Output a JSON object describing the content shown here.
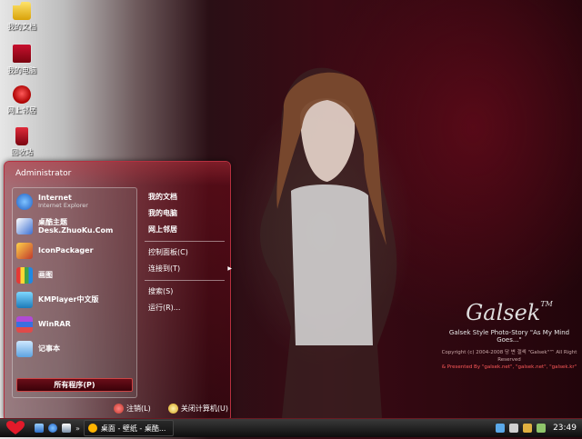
{
  "desktop": {
    "icons": [
      {
        "label": "我的文档",
        "icon": "my-documents-icon"
      },
      {
        "label": "我的电脑",
        "icon": "my-computer-icon"
      },
      {
        "label": "网上邻居",
        "icon": "network-icon"
      },
      {
        "label": "回收站",
        "icon": "recycle-bin-icon"
      }
    ]
  },
  "start_menu": {
    "user": "Administrator",
    "programs": [
      {
        "title": "Internet",
        "subtitle": "Internet Explorer",
        "icon": "internet-explorer-icon",
        "color": "#2a7de1"
      },
      {
        "title": "桌酷主题Desk.ZhuoKu.Com",
        "icon": "zhuoku-theme-icon",
        "color": "#3b6fd1"
      },
      {
        "title": "IconPackager",
        "icon": "iconpackager-icon",
        "color": "#d6a11a"
      },
      {
        "title": "画图",
        "icon": "paint-icon",
        "color": "#e0b441"
      },
      {
        "title": "KMPlayer中文版",
        "icon": "kmplayer-icon",
        "color": "#2fa6d8"
      },
      {
        "title": "WinRAR",
        "icon": "winrar-icon",
        "color": "#7b3ea8"
      },
      {
        "title": "记事本",
        "icon": "notepad-icon",
        "color": "#6fb1e8"
      }
    ],
    "all_programs": "所有程序(P)",
    "right": {
      "group1": [
        "我的文档",
        "我的电脑",
        "网上邻居"
      ],
      "group2": [
        "控制面板(C)",
        "连接到(T)"
      ],
      "group3": [
        "搜索(S)",
        "运行(R)..."
      ]
    },
    "footer": {
      "logoff": "注销(L)",
      "shutdown": "关闭计算机(U)"
    }
  },
  "branding": {
    "logo": "Galsek",
    "tm": "TM",
    "tagline": "Galsek Style Photo-Story \"As My Mind Goes...\"",
    "copyright": "Copyright (c) 2004-2008 당 변 갤섹 \"Galsek\"™ All Right Reserved",
    "presented": "& Presented By \"galsek.net\", \"galsek.net\", \"galsek.kr\""
  },
  "taskbar": {
    "task_label": "桌面 - 壁纸 - 桌酷...",
    "clock": "23:49"
  },
  "colors": {
    "accent": "#b62f3f",
    "brand_red": "#ff5a5a",
    "start_heart": "#e21a2a"
  }
}
